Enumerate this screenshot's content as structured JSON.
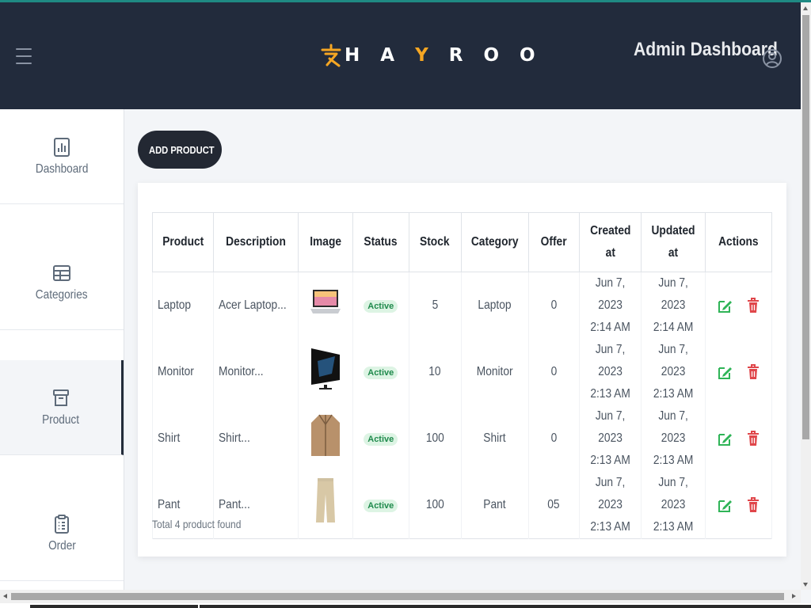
{
  "header": {
    "logo_text_before": "H A ",
    "logo_accent": "Y",
    "logo_text_after": " R O O",
    "title": "Admin Dashboard"
  },
  "sidebar": {
    "items": [
      {
        "label": "Dashboard",
        "icon": "bar-chart-icon"
      },
      {
        "label": "Categories",
        "icon": "table-icon"
      },
      {
        "label": "Product",
        "icon": "archive-icon",
        "active": true
      },
      {
        "label": "Order",
        "icon": "clipboard-icon"
      }
    ]
  },
  "add_button": {
    "label": "ADD PRODUCT"
  },
  "table": {
    "headers": [
      "Product",
      "Description",
      "Image",
      "Status",
      "Stock",
      "Category",
      "Offer",
      "Created\nat",
      "Updated\nat",
      "Actions"
    ],
    "rows": [
      {
        "product": "Laptop",
        "description": "Acer Laptop...",
        "image": "laptop-thumbnail",
        "status": "Active",
        "stock": "5",
        "category": "Laptop",
        "offer": "0",
        "created": "Jun 7, 2023\n2:14 AM",
        "updated": "Jun 7, 2023\n2:14 AM"
      },
      {
        "product": "Monitor",
        "description": "Monitor...",
        "image": "monitor-thumbnail",
        "status": "Active",
        "stock": "10",
        "category": "Monitor",
        "offer": "0",
        "created": "Jun 7, 2023\n2:13 AM",
        "updated": "Jun 7, 2023\n2:13 AM"
      },
      {
        "product": "Shirt",
        "description": "Shirt...",
        "image": "shirt-thumbnail",
        "status": "Active",
        "stock": "100",
        "category": "Shirt",
        "offer": "0",
        "created": "Jun 7, 2023\n2:13 AM",
        "updated": "Jun 7, 2023\n2:13 AM"
      },
      {
        "product": "Pant",
        "description": "Pant...",
        "image": "pant-thumbnail",
        "status": "Active",
        "stock": "100",
        "category": "Pant",
        "offer": "05",
        "created": "Jun 7, 2023\n2:13 AM",
        "updated": "Jun 7, 2023\n2:13 AM"
      }
    ]
  },
  "footer_note": "Total 4 product found",
  "colors": {
    "header_bg": "#222b3c",
    "accent": "#f5a623",
    "active_badge_bg": "#ddf4e4",
    "active_badge_text": "#1f8a4c",
    "edit_icon": "#2fb457",
    "delete_icon": "#e0464a"
  }
}
